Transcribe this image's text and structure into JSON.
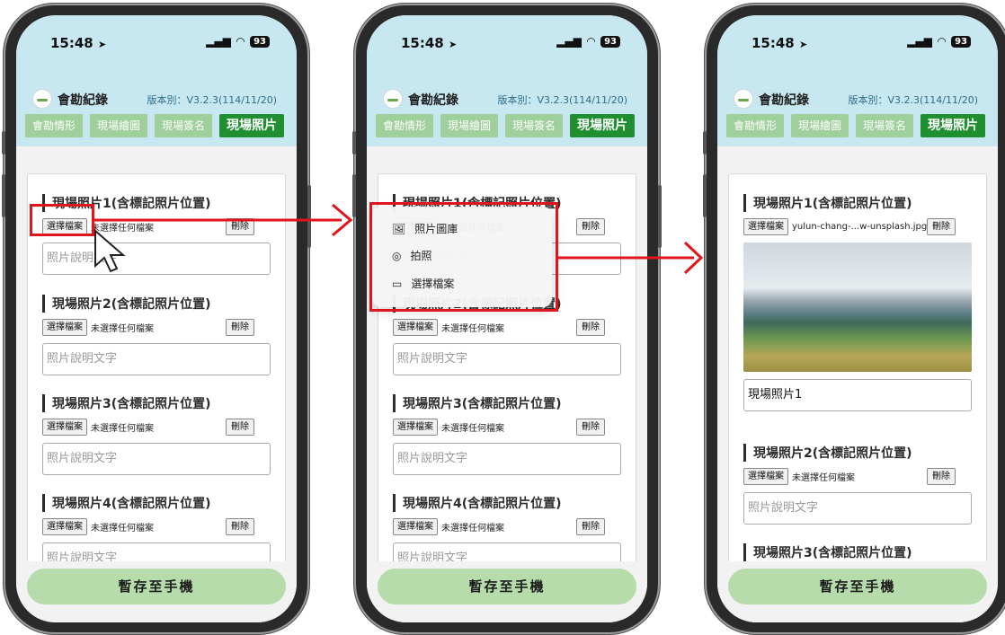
{
  "status": {
    "time": "15:48",
    "battery": "93"
  },
  "app": {
    "title": "會勘紀錄",
    "version": "版本別：V3.2.3(114/11/20)"
  },
  "tabs": [
    "會勘情形",
    "現場繪圖",
    "現場簽名",
    "現場照片"
  ],
  "sections": {
    "p1": {
      "title": "現場照片1(含標記照片位置)"
    },
    "p2": {
      "title": "現場照片2(含標記照片位置)"
    },
    "p3": {
      "title": "現場照片3(含標記照片位置)"
    },
    "p4": {
      "title": "現場照片4(含標記照片位置)"
    }
  },
  "controls": {
    "choose_label": "選擇檔案",
    "no_file": "未選擇任何檔案",
    "delete_label": "刪除",
    "caption_placeholder": "照片說明文字"
  },
  "save_button": "暫存至手機",
  "menu": {
    "items": [
      {
        "label": "照片圖庫",
        "icon": "photo-library-icon"
      },
      {
        "label": "拍照",
        "icon": "camera-icon"
      },
      {
        "label": "選擇檔案",
        "icon": "folder-icon"
      }
    ]
  },
  "phone3": {
    "selected_file": "yulun-chang-...w-unsplash.jpg",
    "caption_value": "現場照片1"
  },
  "colors": {
    "highlight": "#e2141b",
    "tab_active": "#1f8f2f",
    "tab_inactive": "#9fcf9b",
    "header": "#c7e7f1"
  }
}
